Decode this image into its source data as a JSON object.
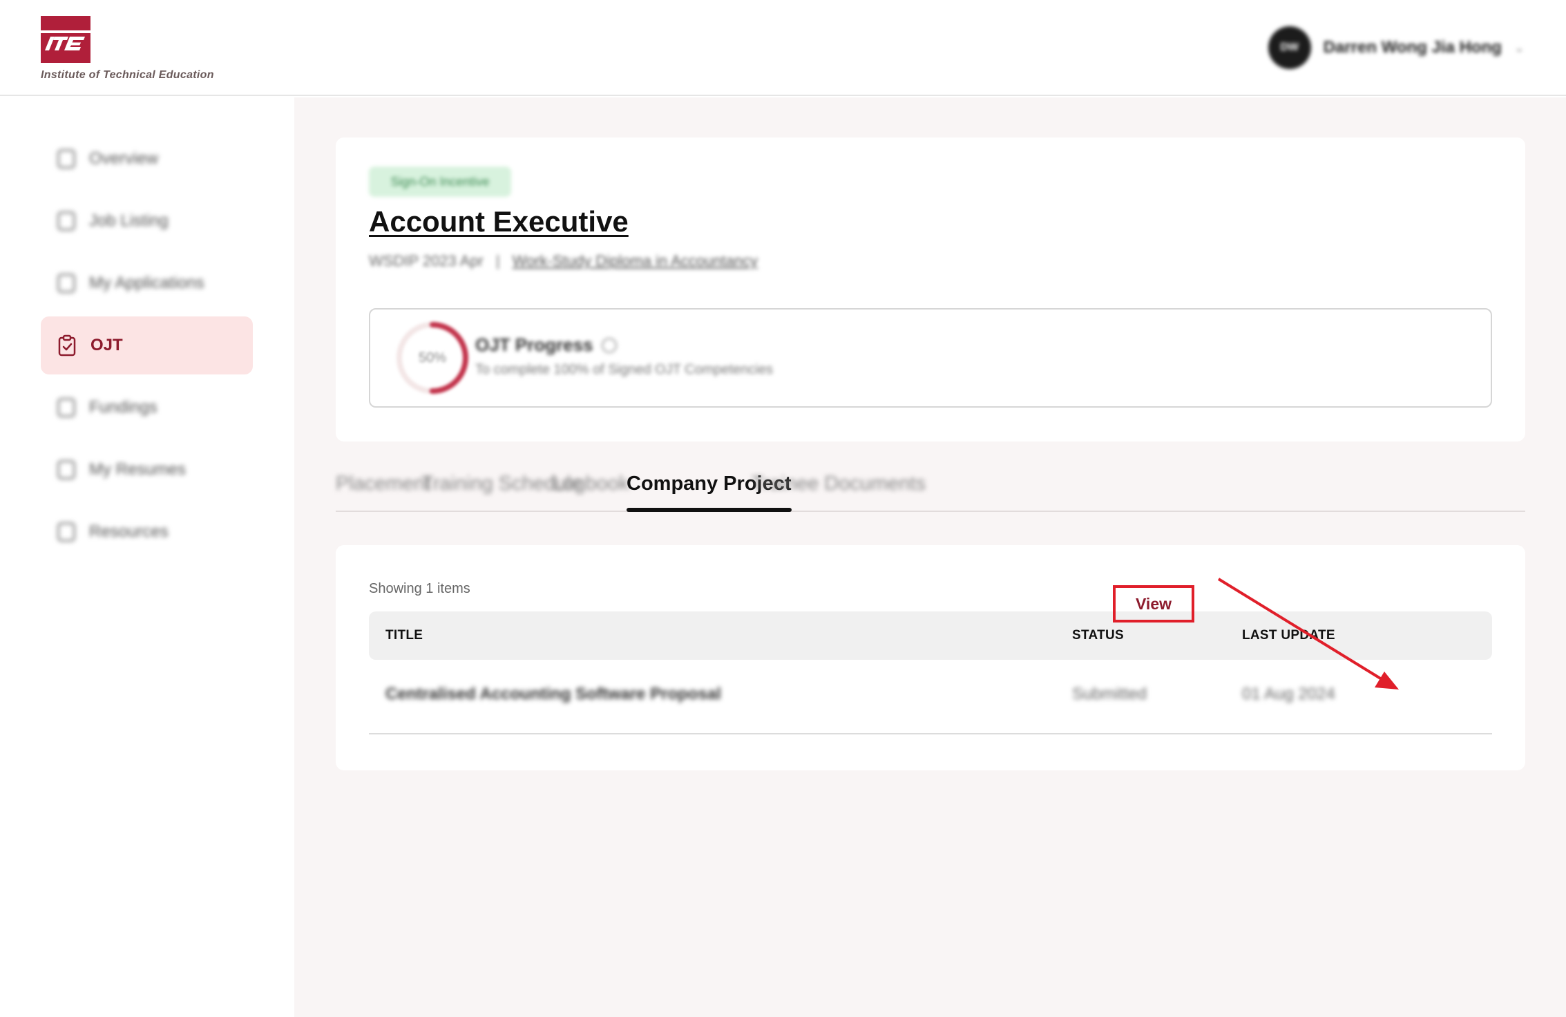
{
  "header": {
    "logo_text": "ITE",
    "logo_subtitle": "Institute of Technical Education",
    "user": {
      "initials": "DW",
      "name": "Darren Wong Jia Hong"
    }
  },
  "sidebar": {
    "items": [
      {
        "label": "Overview",
        "icon": "overview-icon"
      },
      {
        "label": "Job Listing",
        "icon": "briefcase-icon"
      },
      {
        "label": "My Applications",
        "icon": "document-icon"
      },
      {
        "label": "OJT",
        "icon": "clipboard-check-icon",
        "active": true
      },
      {
        "label": "Fundings",
        "icon": "money-icon"
      },
      {
        "label": "My Resumes",
        "icon": "resume-icon"
      },
      {
        "label": "Resources",
        "icon": "folder-icon"
      }
    ]
  },
  "job": {
    "tag": "Sign-On Incentive",
    "title": "Account Executive",
    "intake": "WSDIP 2023 Apr",
    "separator": "|",
    "programme": "Work-Study Diploma in Accountancy",
    "progress": {
      "percent_label": "50%",
      "percent": 50,
      "title": "OJT Progress",
      "subtitle": "To complete 100% of Signed OJT Competencies"
    }
  },
  "tabs": [
    {
      "label": "Placement"
    },
    {
      "label": "Training Schedule"
    },
    {
      "label": "Logbook"
    },
    {
      "label": "Company Project",
      "active": true
    },
    {
      "label": "Trainee Documents"
    }
  ],
  "table": {
    "showing": "Showing 1 items",
    "columns": [
      "TITLE",
      "STATUS",
      "LAST UPDATE"
    ],
    "rows": [
      {
        "title": "Centralised Accounting Software Proposal",
        "status": "Submitted",
        "last_update": "01 Aug 2024",
        "action": "View"
      }
    ]
  },
  "annotation": {
    "color": "#e01f2a"
  }
}
